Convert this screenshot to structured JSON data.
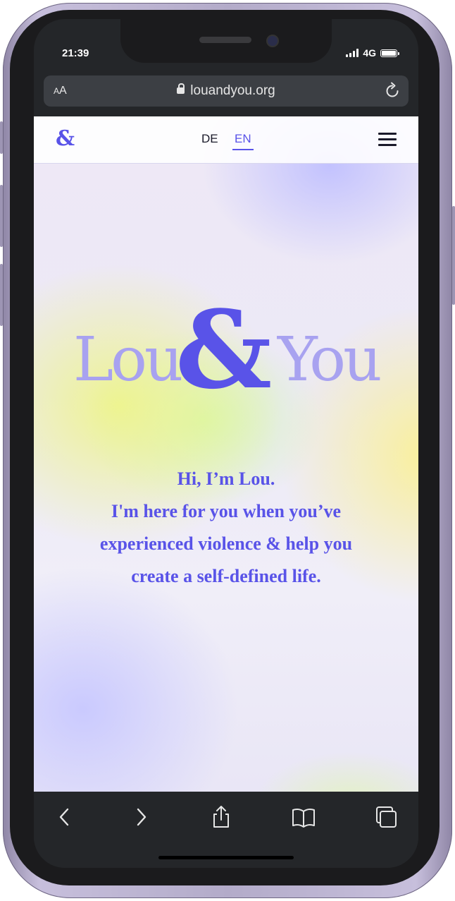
{
  "status_bar": {
    "time": "21:39",
    "network": "4G",
    "icons": [
      "signal-icon",
      "battery-icon"
    ]
  },
  "browser": {
    "text_size_label_small": "A",
    "text_size_label_large": "A",
    "url": "louandyou.org",
    "icons": [
      "lock-icon",
      "reload-icon"
    ]
  },
  "site": {
    "nav": {
      "logo_mark": "&",
      "languages": [
        "DE",
        "EN"
      ],
      "active_language": "EN",
      "menu_icon": "hamburger-menu-icon"
    },
    "logo": {
      "left_word": "Lou",
      "ampersand": "&",
      "right_word": "You"
    },
    "hero_lines": [
      "Hi, I’m Lou.",
      "I'm here for you when you’ve",
      "experienced violence & help you",
      "create a self-defined life."
    ],
    "colors": {
      "accent": "#5953e8",
      "logo_light": "#a8a2f0"
    }
  },
  "toolbar": {
    "icons": [
      "back-icon",
      "forward-icon",
      "share-icon",
      "bookmarks-icon",
      "tabs-icon"
    ]
  }
}
